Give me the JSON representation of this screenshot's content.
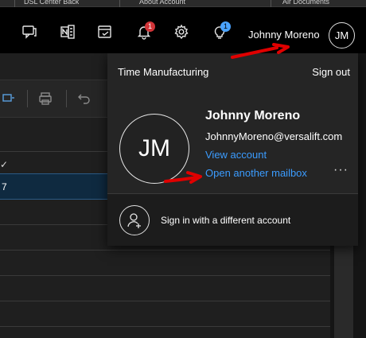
{
  "browser_tabs": [
    "DSL Center Back",
    "About Account",
    "Air Documents"
  ],
  "header": {
    "username": "Johnny Moreno",
    "avatar_initials": "JM",
    "icons": [
      "chat-icon",
      "onenote-icon",
      "todo-icon",
      "bell-icon",
      "gear-icon",
      "lightbulb-icon"
    ],
    "notifications_badge": "1",
    "tips_badge": "1",
    "colors": {
      "notification_badge": "#d13438",
      "tips_badge": "#4aa3ff"
    }
  },
  "background": {
    "selected_row_text": "7",
    "check_glyph": "✓"
  },
  "account_panel": {
    "organization": "Time Manufacturing",
    "sign_out": "Sign out",
    "avatar_initials": "JM",
    "full_name": "Johnny Moreno",
    "email": "JohnnyMoreno@versalift.com",
    "view_account": "View account",
    "open_mailbox": "Open another mailbox",
    "more": "···",
    "sign_in_other": "Sign in with a different account",
    "link_color": "#3b9cff"
  },
  "annotations": {
    "color": "#e00000"
  }
}
